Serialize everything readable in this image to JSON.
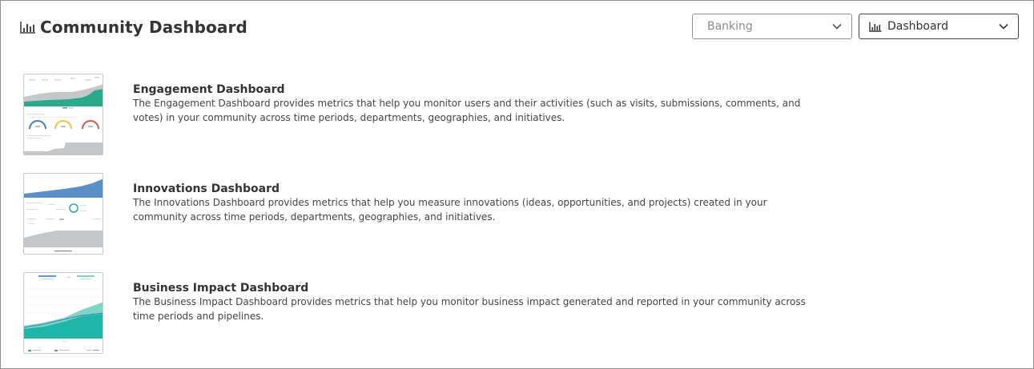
{
  "page": {
    "title": "Community Dashboard",
    "title_icon": "bar-chart-icon"
  },
  "filters": {
    "community": {
      "value": "Banking",
      "icon": "chevron-down-icon"
    },
    "view": {
      "value": "Dashboard",
      "icon": "bar-chart-icon"
    }
  },
  "dashboards": [
    {
      "title": "Engagement Dashboard",
      "description": "The Engagement Dashboard provides metrics that help you monitor users and their activities (such as visits, submissions, comments, and votes) in your community across time periods, departments, geographies, and initiatives."
    },
    {
      "title": "Innovations Dashboard",
      "description": "The Innovations Dashboard provides metrics that help you measure innovations (ideas, opportunities, and projects) created in your community across time periods, departments, geographies, and initiatives."
    },
    {
      "title": "Business Impact Dashboard",
      "description": "The Business Impact Dashboard provides metrics that help you monitor business impact generated and reported in your community across time periods and pipelines."
    }
  ],
  "colors": {
    "engagement_accent": "#2aaa8a",
    "innovations_accent": "#5b8fc7",
    "business_accent": "#1fb5a8",
    "muted_gray": "#c5c8cb"
  }
}
